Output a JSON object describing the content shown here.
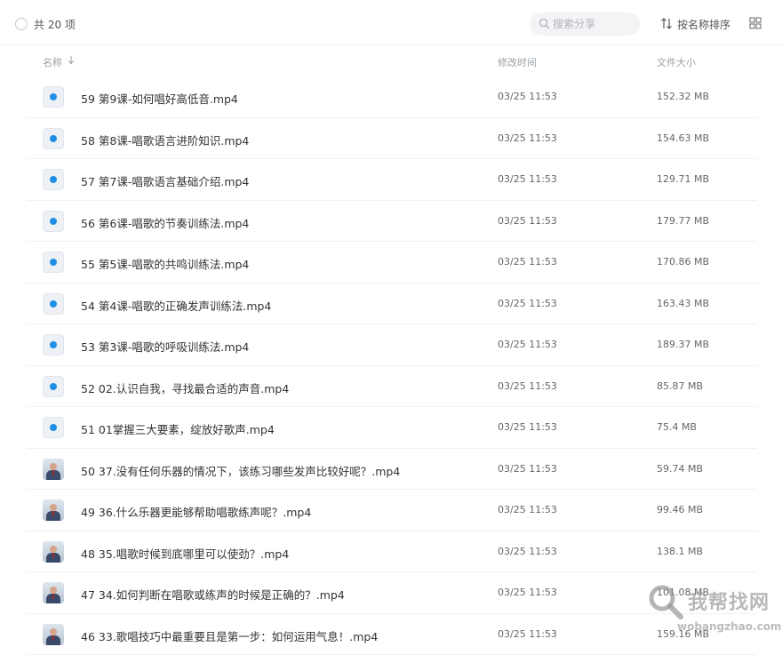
{
  "toolbar": {
    "count_label": "共 20 项",
    "search_placeholder": "搜索分享",
    "sort_label": "按名称排序"
  },
  "columns": {
    "name": "名称",
    "time": "修改时间",
    "size": "文件大小"
  },
  "files": [
    {
      "name": "59 第9课-如何唱好高低音.mp4",
      "time": "03/25 11:53",
      "size": "152.32 MB",
      "thumb": "video"
    },
    {
      "name": "58 第8课-唱歌语言进阶知识.mp4",
      "time": "03/25 11:53",
      "size": "154.63 MB",
      "thumb": "video"
    },
    {
      "name": "57 第7课-唱歌语言基础介绍.mp4",
      "time": "03/25 11:53",
      "size": "129.71 MB",
      "thumb": "video"
    },
    {
      "name": "56 第6课-唱歌的节奏训练法.mp4",
      "time": "03/25 11:53",
      "size": "179.77 MB",
      "thumb": "video"
    },
    {
      "name": "55 第5课-唱歌的共鸣训练法.mp4",
      "time": "03/25 11:53",
      "size": "170.86 MB",
      "thumb": "video"
    },
    {
      "name": "54 第4课-唱歌的正确发声训练法.mp4",
      "time": "03/25 11:53",
      "size": "163.43 MB",
      "thumb": "video"
    },
    {
      "name": "53 第3课-唱歌的呼吸训练法.mp4",
      "time": "03/25 11:53",
      "size": "189.37 MB",
      "thumb": "video"
    },
    {
      "name": "52 02.认识自我，寻找最合适的声音.mp4",
      "time": "03/25 11:53",
      "size": "85.87 MB",
      "thumb": "video"
    },
    {
      "name": "51 01掌握三大要素，绽放好歌声.mp4",
      "time": "03/25 11:53",
      "size": "75.4 MB",
      "thumb": "video"
    },
    {
      "name": "50 37.没有任何乐器的情况下，该练习哪些发声比较好呢？.mp4",
      "time": "03/25 11:53",
      "size": "59.74 MB",
      "thumb": "photo"
    },
    {
      "name": "49 36.什么乐器更能够帮助唱歌练声呢？.mp4",
      "time": "03/25 11:53",
      "size": "99.46 MB",
      "thumb": "photo"
    },
    {
      "name": "48 35.唱歌时候到底哪里可以使劲？.mp4",
      "time": "03/25 11:53",
      "size": "138.1 MB",
      "thumb": "photo"
    },
    {
      "name": "47 34.如何判断在唱歌或练声的时候是正确的？.mp4",
      "time": "03/25 11:53",
      "size": "101.08 MB",
      "thumb": "photo"
    },
    {
      "name": "46 33.歌唱技巧中最重要且是第一步：如何运用气息！.mp4",
      "time": "03/25 11:53",
      "size": "159.16 MB",
      "thumb": "photo"
    }
  ],
  "watermark": {
    "title": "我帮找网",
    "url": "wobangzhao.com"
  },
  "colors": {
    "video_icon": "#1f8fe5",
    "divider": "#f0f0f0",
    "muted_text": "#9aa0a6"
  }
}
